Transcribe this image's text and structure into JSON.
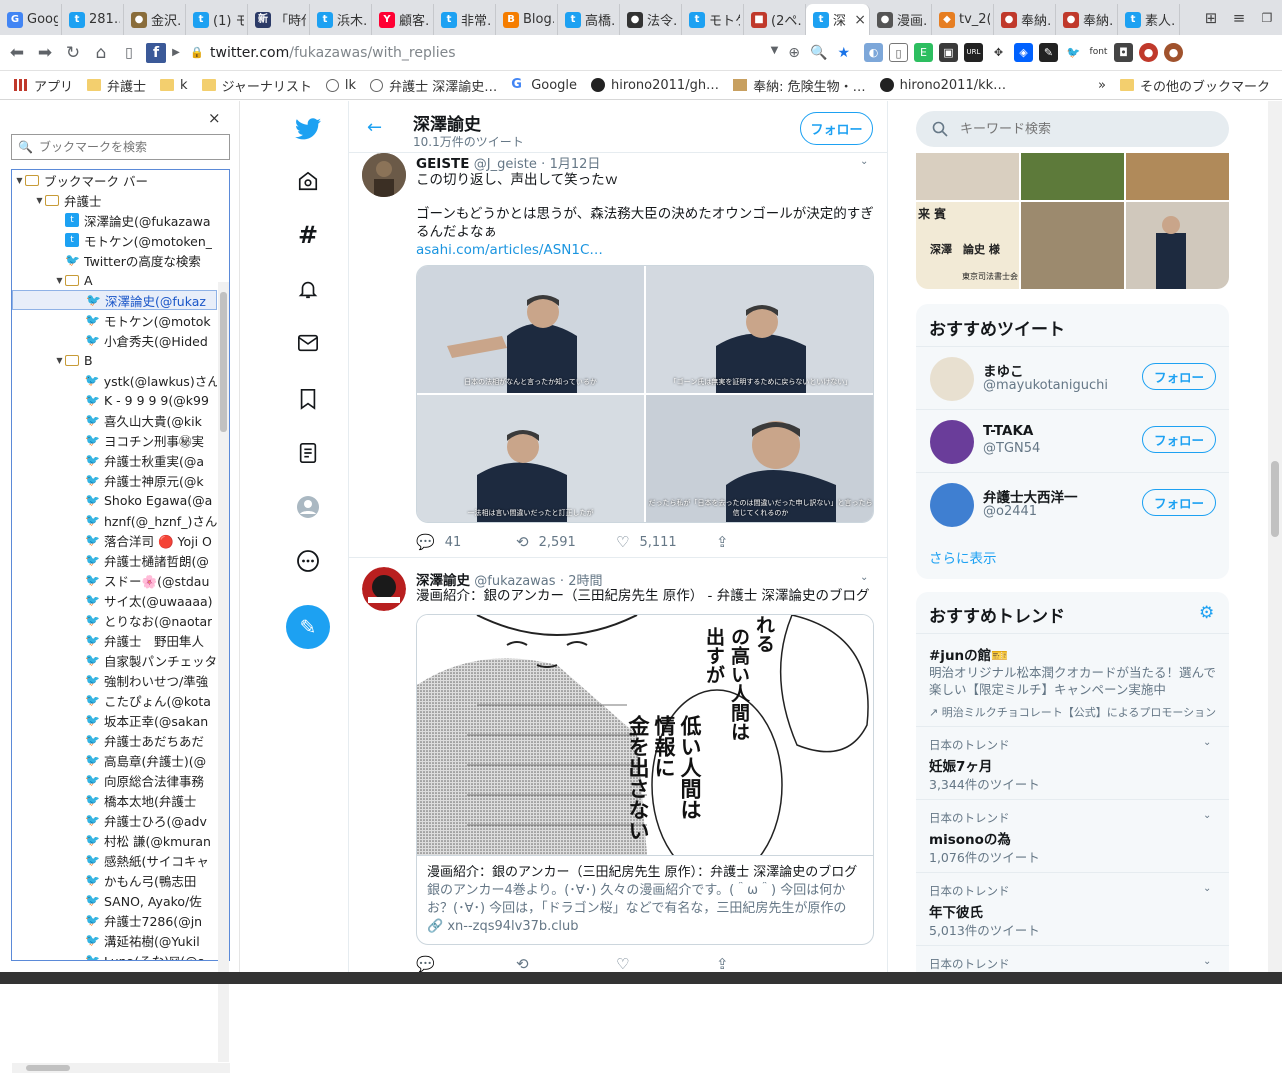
{
  "tabs": [
    {
      "title": "Google",
      "fav_color": "#4285f4",
      "glyph": "G"
    },
    {
      "title": "281…",
      "fav_color": "#1da1f2",
      "glyph": "t"
    },
    {
      "title": "金沢…",
      "fav_color": "#8a6d3b",
      "glyph": "●"
    },
    {
      "title": "(1) モ…",
      "fav_color": "#1da1f2",
      "glyph": "t"
    },
    {
      "title": "「時代…",
      "fav_color": "#2b3a67",
      "glyph": "新"
    },
    {
      "title": "浜木…",
      "fav_color": "#1da1f2",
      "glyph": "t"
    },
    {
      "title": "顧客…",
      "fav_color": "#ff0033",
      "glyph": "Y"
    },
    {
      "title": "非常…",
      "fav_color": "#1da1f2",
      "glyph": "t"
    },
    {
      "title": "Blog…",
      "fav_color": "#f57d00",
      "glyph": "B"
    },
    {
      "title": "高橋…",
      "fav_color": "#1da1f2",
      "glyph": "t"
    },
    {
      "title": "法令…",
      "fav_color": "#333333",
      "glyph": "●"
    },
    {
      "title": "モトケ…",
      "fav_color": "#1da1f2",
      "glyph": "t"
    },
    {
      "title": "(2ペ…",
      "fav_color": "#c0392b",
      "glyph": "■"
    },
    {
      "title": "深",
      "fav_color": "#1da1f2",
      "glyph": "t",
      "active": true,
      "close": "×"
    },
    {
      "title": "漫画…",
      "fav_color": "#555555",
      "glyph": "●"
    },
    {
      "title": "tv_2(…",
      "fav_color": "#e67e22",
      "glyph": "◆"
    },
    {
      "title": "奉納…",
      "fav_color": "#c0392b",
      "glyph": "●"
    },
    {
      "title": "奉納…",
      "fav_color": "#c0392b",
      "glyph": "●"
    },
    {
      "title": "素人…",
      "fav_color": "#1da1f2",
      "glyph": "t"
    }
  ],
  "toolbar": {
    "url_host": "twitter.com",
    "url_path": "/fukazawas/with_replies"
  },
  "bookmarks_bar": {
    "items": [
      {
        "label": "アプリ",
        "type": "apps"
      },
      {
        "label": "弁護士",
        "type": "folder"
      },
      {
        "label": "k",
        "type": "folder"
      },
      {
        "label": "ジャーナリスト",
        "type": "folder"
      },
      {
        "label": "lk",
        "type": "globe"
      },
      {
        "label": "弁護士 深澤諭史…",
        "type": "globe"
      },
      {
        "label": "Google",
        "type": "google"
      },
      {
        "label": "hirono2011/gh…",
        "type": "github"
      },
      {
        "label": "奉納: 危険生物・…",
        "type": "site"
      },
      {
        "label": "hirono2011/kk…",
        "type": "github"
      }
    ],
    "overflow": "»",
    "other": "その他のブックマーク"
  },
  "bm_panel": {
    "close": "×",
    "search_placeholder": "ブックマークを検索",
    "tree": [
      {
        "label": "ブックマーク バー",
        "type": "folder",
        "level": 0,
        "open": true
      },
      {
        "label": "弁護士",
        "type": "folder",
        "level": 1,
        "open": true
      },
      {
        "label": "深澤論史(@fukazawa",
        "type": "badge",
        "level": 2
      },
      {
        "label": "モトケン(@motoken_",
        "type": "badge",
        "level": 2
      },
      {
        "label": "Twitterの高度な検索",
        "type": "tw",
        "level": 2
      },
      {
        "label": "A",
        "type": "folder",
        "level": 2,
        "open": true
      },
      {
        "label": "深澤論史(@fukaz",
        "type": "tw",
        "level": 3,
        "selected": true
      },
      {
        "label": "モトケン(@motok",
        "type": "tw",
        "level": 3
      },
      {
        "label": "小倉秀夫(@Hided",
        "type": "tw",
        "level": 3
      },
      {
        "label": "B",
        "type": "folder",
        "level": 2,
        "open": true
      },
      {
        "label": "ystk(@lawkus)さん",
        "type": "tw",
        "level": 3
      },
      {
        "label": "K - 9 9 9 9(@k99",
        "type": "tw",
        "level": 3
      },
      {
        "label": "喜久山大貴(@kik",
        "type": "tw",
        "level": 3
      },
      {
        "label": "ヨコチン刑事㊙実",
        "type": "tw",
        "level": 3
      },
      {
        "label": "弁護士秋重実(@a",
        "type": "tw",
        "level": 3
      },
      {
        "label": "弁護士神原元(@k",
        "type": "tw",
        "level": 3
      },
      {
        "label": "Shoko Egawa(@a",
        "type": "tw",
        "level": 3
      },
      {
        "label": "hznf(@_hznf_)さん",
        "type": "tw",
        "level": 3
      },
      {
        "label": "落合洋司 🔴 Yoji O",
        "type": "tw",
        "level": 3
      },
      {
        "label": "弁護士樋諸哲朗(@",
        "type": "tw",
        "level": 3
      },
      {
        "label": "スドー🌸(@stdau",
        "type": "tw",
        "level": 3
      },
      {
        "label": "サイ太(@uwaaaa)",
        "type": "tw",
        "level": 3
      },
      {
        "label": "とりなお(@naotar",
        "type": "tw",
        "level": 3
      },
      {
        "label": "弁護士　野田隼人",
        "type": "tw",
        "level": 3
      },
      {
        "label": "自家製パンチェッタ",
        "type": "tw",
        "level": 3
      },
      {
        "label": "強制わいせつ/準強",
        "type": "tw",
        "level": 3
      },
      {
        "label": "こたぴょん(@kota",
        "type": "tw",
        "level": 3
      },
      {
        "label": "坂本正幸(@sakan",
        "type": "tw",
        "level": 3
      },
      {
        "label": "弁護士あだちあだ",
        "type": "tw",
        "level": 3
      },
      {
        "label": "高島章(弁護士)(@",
        "type": "tw",
        "level": 3
      },
      {
        "label": "向原総合法律事務",
        "type": "tw",
        "level": 3
      },
      {
        "label": "橋本太地(弁護士",
        "type": "tw",
        "level": 3
      },
      {
        "label": "弁護士ひろ(@adv",
        "type": "tw",
        "level": 3
      },
      {
        "label": "村松 謙(@kmuran",
        "type": "tw",
        "level": 3
      },
      {
        "label": "感熱紙(サイコキャ",
        "type": "tw",
        "level": 3
      },
      {
        "label": "かもん弓(鴨志田",
        "type": "tw",
        "level": 3
      },
      {
        "label": "SANO, Ayako/佐",
        "type": "tw",
        "level": 3
      },
      {
        "label": "弁護士7286(@jn",
        "type": "tw",
        "level": 3
      },
      {
        "label": "溝延祐樹(@Yukil",
        "type": "tw",
        "level": 3
      },
      {
        "label": "Luna(るな)☒(@s",
        "type": "tw",
        "level": 3
      }
    ]
  },
  "twitter": {
    "header": {
      "back": "←",
      "name": "深澤諭史",
      "count": "10.1万件のツイート",
      "follow": "フォロー"
    },
    "tweets": [
      {
        "name": "GEISTE",
        "handle": "@J_geiste",
        "sep": "·",
        "time": "1月12日",
        "line1": "この切り返し、声出して笑ったｗ",
        "line2": "ゴーンもどうかとは思うが、森法務大臣の決めたオウンゴールが決定的すぎるんだよなぁ",
        "link": "asahi.com/articles/ASN1C…",
        "captions": [
          "日本の法相がなんと言ったか知っているか",
          "「ゴーン氏は無実を証明するために戻らないといけない」",
          "一法相は言い間違いだったと訂正したが",
          "だったら私が「日本を去ったのは間違いだった申し訳ない」と言ったら信じてくれるのか"
        ],
        "reply": "41",
        "retweet": "2,591",
        "like": "5,111"
      },
      {
        "name": "深澤諭史",
        "handle": "@fukazawas",
        "sep": "·",
        "time": "2時間",
        "line1": "漫画紹介：銀のアンカー（三田紀房先生 原作） - 弁護士 深澤論史のブログ",
        "manga_text": [
          "れる",
          "の高い人間は",
          "出すが",
          "低い人間は",
          "情報に",
          "金を出さない"
        ],
        "card_title": "漫画紹介：銀のアンカー（三田紀房先生 原作）：弁護士 深澤論史のブログ",
        "card_desc": "銀のアンカー4巻より。(･∀･) 久々の漫画紹介です。(＾ω＾) 今回は何かお？(･∀･) 今回は，「ドラゴン桜」などで有名な，三田紀房先生が原作の「銀の…",
        "card_domain": "xn--zqs94lv37b.club",
        "reply": "",
        "retweet": "",
        "like": ""
      }
    ],
    "photo_labels": {
      "raihin": "来 賓",
      "name_plate": "深澤　論史 様",
      "assoc": "東京司法書士会"
    }
  },
  "right": {
    "search_placeholder": "キーワード検索",
    "recommended_title": "おすすめツイート",
    "users": [
      {
        "name": "まゆこ",
        "handle": "@mayukotaniguchi",
        "follow": "フォロー",
        "av": "#e8e0d0"
      },
      {
        "name": "T-TAKA",
        "handle": "@TGN54",
        "follow": "フォロー",
        "av": "#6a3d9a"
      },
      {
        "name": "弁護士大西洋一",
        "handle": "@o2441",
        "follow": "フォロー",
        "av": "#3f7fd1"
      }
    ],
    "show_more": "さらに表示",
    "trends_title": "おすすめトレンド",
    "promoted": {
      "tag": "#junの館🎫",
      "desc": "明治オリジナル松本潤クオカードが当たる！選んで楽しい【限定ミルチ】キャンペーン実施中",
      "by": "明治ミルクチョコレート【公式】によるプロモーション"
    },
    "trends": [
      {
        "label": "日本のトレンド",
        "name": "妊娠7ヶ月",
        "count": "3,344件のツイート"
      },
      {
        "label": "日本のトレンド",
        "name": "misonoの為",
        "count": "1,076件のツイート"
      },
      {
        "label": "日本のトレンド",
        "name": "年下彼氏",
        "count": "5,013件のツイート"
      },
      {
        "label": "日本のトレンド",
        "name": "",
        "count": ""
      }
    ]
  },
  "colors": {
    "twitter_blue": "#1da1f2",
    "chrome_bg": "#dfe1e5"
  }
}
